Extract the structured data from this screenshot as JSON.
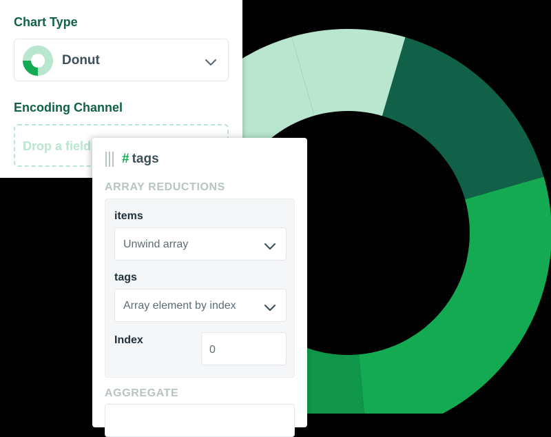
{
  "colors": {
    "brand_dark": "#116149",
    "brand_green": "#13aa52",
    "segment_colors": [
      "#b8e6cf",
      "#116149",
      "#13aa52",
      "#109648",
      "#b8e6cf"
    ]
  },
  "chart_data": {
    "type": "pie",
    "variant": "donut",
    "note_values_estimated": true,
    "categories": [
      "",
      "",
      "",
      "",
      ""
    ],
    "values": [
      9,
      16,
      28,
      22,
      25
    ]
  },
  "chart_type_panel": {
    "title": "Chart Type",
    "selected": "Donut",
    "selected_icon": "donut-chart-icon",
    "encoding_title": "Encoding Channel",
    "dropzone_placeholder": "Drop a field"
  },
  "field_card": {
    "icon": "drag-handle-icon",
    "type_symbol": "#",
    "field_name": "tags",
    "array_reductions_title": "ARRAY REDUCTIONS",
    "items_label": "items",
    "items_value": "Unwind array",
    "tags_label": "tags",
    "tags_value": "Array element by index",
    "index_label": "Index",
    "index_value": "0",
    "aggregate_title": "AGGREGATE"
  }
}
